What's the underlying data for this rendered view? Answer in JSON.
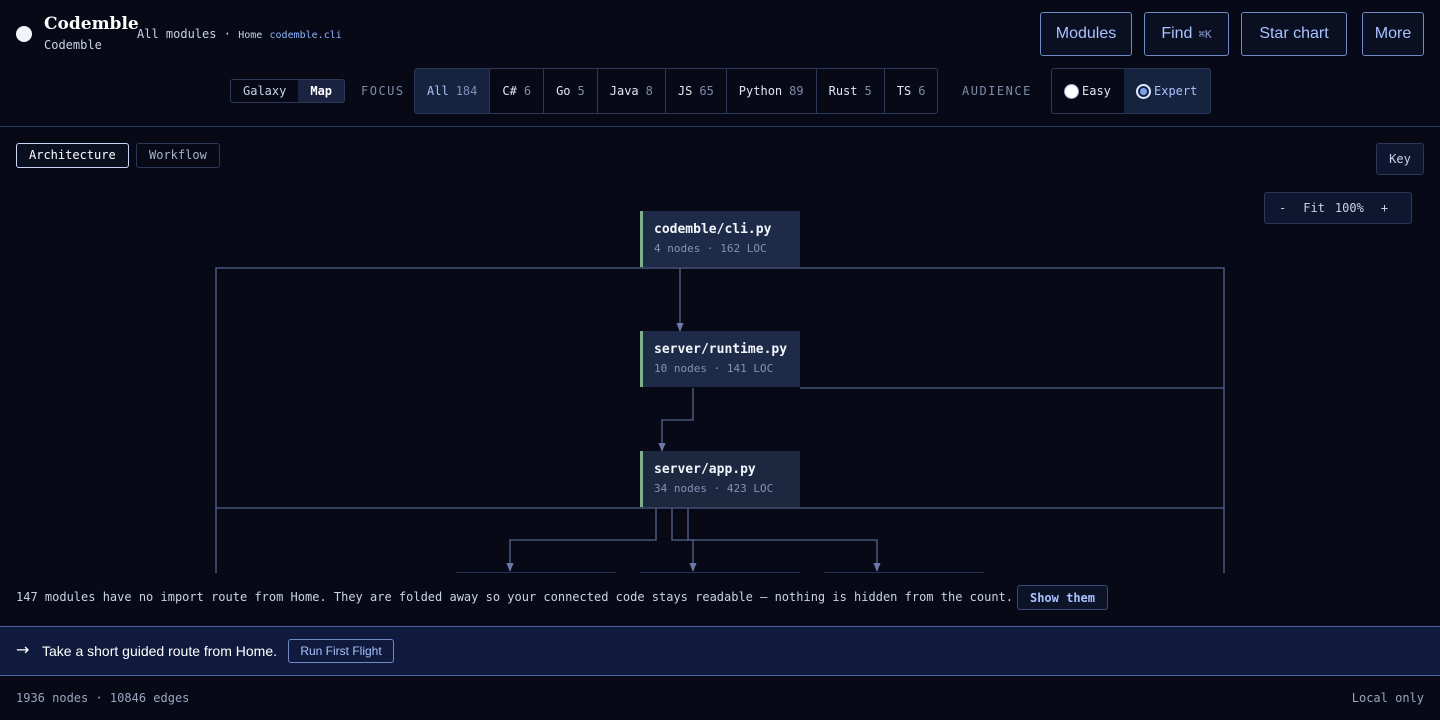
{
  "brand": {
    "title": "Codemble",
    "subtitle": "Codemble"
  },
  "breadcrumb": {
    "root": "All modules",
    "sep": "·",
    "home": "Home",
    "current": "codemble.cli"
  },
  "nav": {
    "modules": "Modules",
    "find": "Find",
    "find_shortcut": "⌘K",
    "star_chart": "Star chart",
    "more": "More"
  },
  "view_mode": {
    "galaxy": "Galaxy",
    "map": "Map",
    "selected": "Map"
  },
  "focus": {
    "label": "FOCUS",
    "chips": [
      {
        "name": "All",
        "count": "184"
      },
      {
        "name": "C#",
        "count": "6"
      },
      {
        "name": "Go",
        "count": "5"
      },
      {
        "name": "Java",
        "count": "8"
      },
      {
        "name": "JS",
        "count": "65"
      },
      {
        "name": "Python",
        "count": "89"
      },
      {
        "name": "Rust",
        "count": "5"
      },
      {
        "name": "TS",
        "count": "6"
      }
    ],
    "selected": "All"
  },
  "audience": {
    "label": "AUDIENCE",
    "easy": "Easy",
    "expert": "Expert",
    "selected": "Expert"
  },
  "tabs": {
    "architecture": "Architecture",
    "workflow": "Workflow",
    "selected": "Architecture"
  },
  "key_button": "Key",
  "zoom": {
    "minus": "-",
    "fit": "Fit",
    "level": "100%",
    "plus": "+"
  },
  "nodes": [
    {
      "name": "codemble/cli.py",
      "meta": "4 nodes · 162 LOC"
    },
    {
      "name": "server/runtime.py",
      "meta": "10 nodes · 141 LOC"
    },
    {
      "name": "server/app.py",
      "meta": "34 nodes · 423 LOC"
    }
  ],
  "notice": {
    "text": "147 modules have no import route from Home. They are folded away so your connected code stays readable — nothing is hidden from the count.",
    "button": "Show them"
  },
  "banner": {
    "arrow": "→",
    "text": "Take a short guided route from Home.",
    "button": "Run First Flight"
  },
  "footer": {
    "stats": "1936 nodes · 10846 edges",
    "mode": "Local only"
  },
  "colors": {
    "background": "#070a16",
    "accent": "#a9c3ff",
    "node_bar": "#7fb08c",
    "banner": "#0f1a3c"
  }
}
